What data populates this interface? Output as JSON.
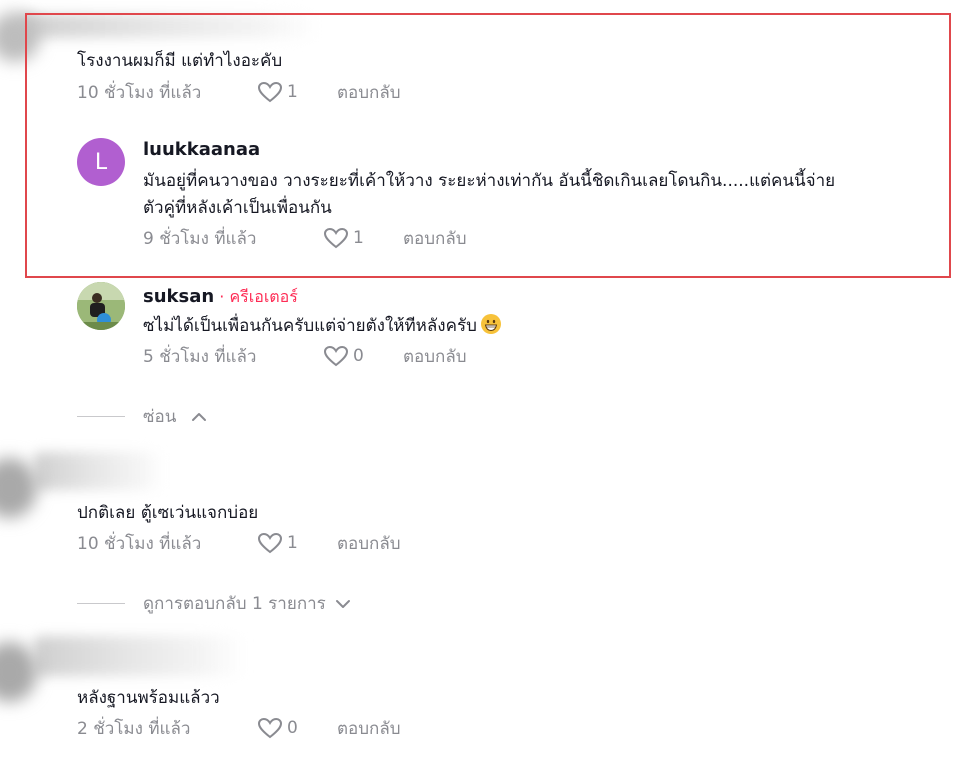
{
  "comments": [
    {
      "text": "โรงงานผมก็มี แต่ทำไงอะคับ",
      "time": "10 ชั่วโมง ที่แล้ว",
      "likes": "1",
      "reply_label": "ตอบกลับ"
    },
    {
      "username": "luukkaanaa",
      "avatar_letter": "L",
      "avatar_color": "#b15fd0",
      "text_line1": "มันอยู่ที่คนวางของ วางระยะที่เค้าให้วาง ระยะห่างเท่ากัน อันนี้ชิดเกินเลยโดนกิน.....แต่คนนี้จ่าย",
      "text_line2": "ตัวคู่ที่หลังเค้าเป็นเพื่อนกัน",
      "time": "9 ชั่วโมง ที่แล้ว",
      "likes": "1",
      "reply_label": "ตอบกลับ"
    },
    {
      "username": "suksan",
      "creator_tag": " · ครีเอเตอร์",
      "text": "ซไม่ได้เป็นเพื่อนกันครับแต่จ่ายตังให้ทีหลังครับ",
      "emoji": "grinning-face-emoji",
      "time": "5 ชั่วโมง ที่แล้ว",
      "likes": "0",
      "reply_label": "ตอบกลับ"
    },
    {
      "text": "ปกติเลย ตู้เซเว่นแจกบ่อย",
      "time": "10 ชั่วโมง ที่แล้ว",
      "likes": "1",
      "reply_label": "ตอบกลับ"
    },
    {
      "text": "หลังฐานพร้อมแล้วว",
      "time": "2 ชั่วโมง ที่แล้ว",
      "likes": "0",
      "reply_label": "ตอบกลับ"
    }
  ],
  "hide_replies_label": "ซ่อน",
  "view_replies_label": "ดูการตอบกลับ 1 รายการ",
  "colors": {
    "highlight_border": "#e0474c",
    "creator_accent": "#fe2c55",
    "meta_gray": "#8a8b91"
  }
}
